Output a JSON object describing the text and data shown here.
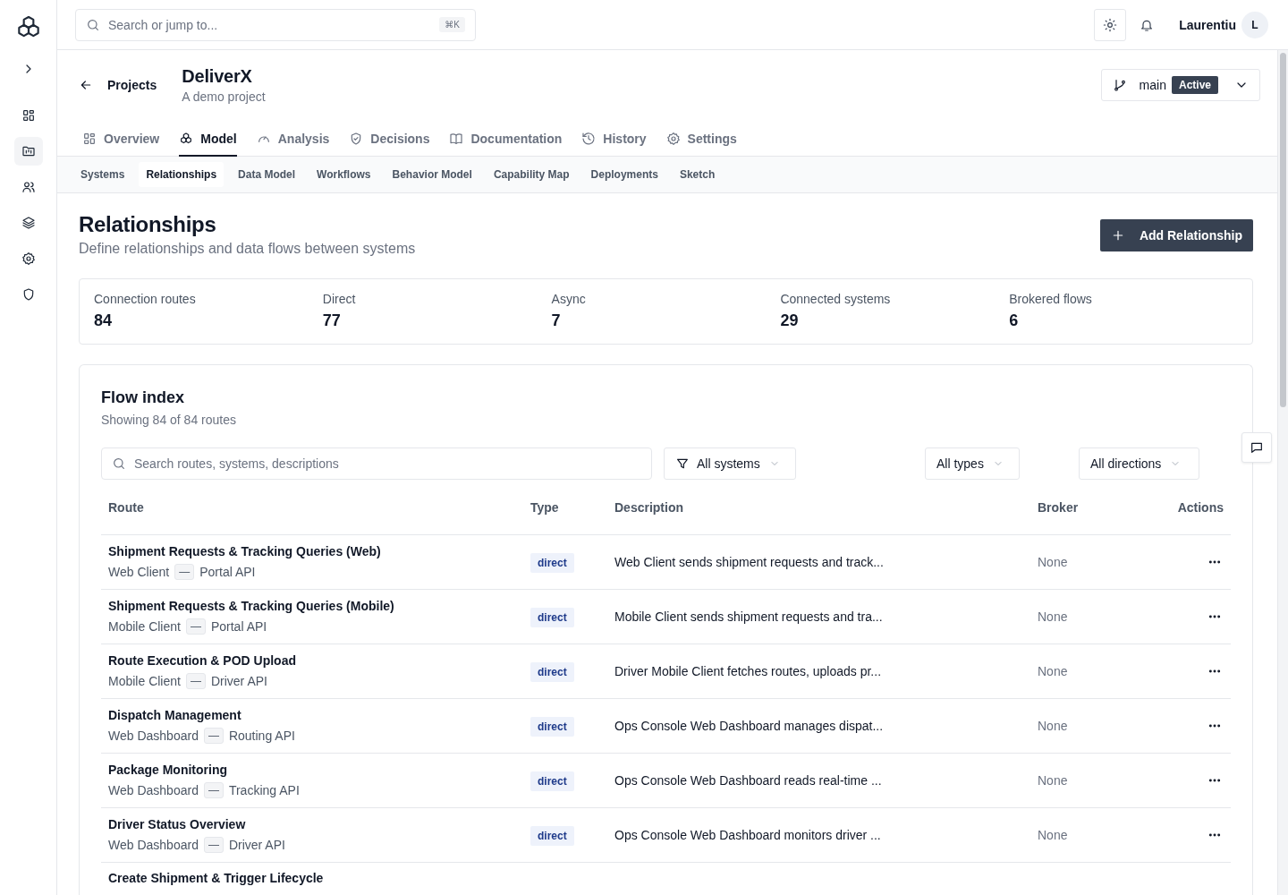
{
  "sidebar": {
    "items": [
      {
        "selected": false
      },
      {
        "selected": true
      },
      {
        "selected": false
      },
      {
        "selected": false
      },
      {
        "selected": false
      },
      {
        "selected": false
      }
    ]
  },
  "topbar": {
    "search": {
      "placeholder": "Search or jump to..."
    },
    "shortcut": "⌘K",
    "user": "Laurentiu",
    "avatar": "L"
  },
  "header": {
    "back": "Projects",
    "title": "DeliverX",
    "subtitle": "A demo project",
    "branch": "main",
    "branch_status": "Active"
  },
  "tabs": [
    {
      "label": "Overview",
      "selected": false
    },
    {
      "label": "Model",
      "selected": true
    },
    {
      "label": "Analysis",
      "selected": false
    },
    {
      "label": "Decisions",
      "selected": false
    },
    {
      "label": "Documentation",
      "selected": false
    },
    {
      "label": "History",
      "selected": false
    },
    {
      "label": "Settings",
      "selected": false
    }
  ],
  "subtabs": [
    {
      "label": "Systems",
      "selected": false
    },
    {
      "label": "Relationships",
      "selected": true
    },
    {
      "label": "Data Model",
      "selected": false
    },
    {
      "label": "Workflows",
      "selected": false
    },
    {
      "label": "Behavior Model",
      "selected": false
    },
    {
      "label": "Capability Map",
      "selected": false
    },
    {
      "label": "Deployments",
      "selected": false
    },
    {
      "label": "Sketch",
      "selected": false
    }
  ],
  "page": {
    "title": "Relationships",
    "subtitle": "Define relationships and data flows between systems",
    "add_button": "Add Relationship"
  },
  "stats": [
    {
      "label": "Connection routes",
      "value": "84"
    },
    {
      "label": "Direct",
      "value": "77"
    },
    {
      "label": "Async",
      "value": "7"
    },
    {
      "label": "Connected systems",
      "value": "29"
    },
    {
      "label": "Brokered flows",
      "value": "6"
    }
  ],
  "flow_index": {
    "title": "Flow index",
    "subtitle": "Showing 84 of 84 routes",
    "search": {
      "placeholder": "Search routes, systems, descriptions"
    },
    "filters": [
      "All systems",
      "All types",
      "All directions"
    ],
    "table": {
      "columns": [
        "Route",
        "Type",
        "Description",
        "Broker",
        "Actions"
      ],
      "rows": [
        {
          "route": "Shipment Requests & Tracking Queries (Web)",
          "path": [
            {
              "kind": "system",
              "text": "Web Client"
            },
            {
              "kind": "link",
              "text": "—"
            },
            {
              "kind": "system",
              "text": "Portal API"
            }
          ],
          "type": "direct",
          "description": "Web Client sends shipment requests and track...",
          "broker": "None"
        },
        {
          "route": "Shipment Requests & Tracking Queries (Mobile)",
          "path": [
            {
              "kind": "system",
              "text": "Mobile Client"
            },
            {
              "kind": "link",
              "text": "—"
            },
            {
              "kind": "system",
              "text": "Portal API"
            }
          ],
          "type": "direct",
          "description": "Mobile Client sends shipment requests and tra...",
          "broker": "None"
        },
        {
          "route": "Route Execution & POD Upload",
          "path": [
            {
              "kind": "system",
              "text": "Mobile Client"
            },
            {
              "kind": "link",
              "text": "—"
            },
            {
              "kind": "system",
              "text": "Driver API"
            }
          ],
          "type": "direct",
          "description": "Driver Mobile Client fetches routes, uploads pr...",
          "broker": "None"
        },
        {
          "route": "Dispatch Management",
          "path": [
            {
              "kind": "system",
              "text": "Web Dashboard"
            },
            {
              "kind": "link",
              "text": "—"
            },
            {
              "kind": "system",
              "text": "Routing API"
            }
          ],
          "type": "direct",
          "description": "Ops Console Web Dashboard manages dispat...",
          "broker": "None"
        },
        {
          "route": "Package Monitoring",
          "path": [
            {
              "kind": "system",
              "text": "Web Dashboard"
            },
            {
              "kind": "link",
              "text": "—"
            },
            {
              "kind": "system",
              "text": "Tracking API"
            }
          ],
          "type": "direct",
          "description": "Ops Console Web Dashboard reads real-time ...",
          "broker": "None"
        },
        {
          "route": "Driver Status Overview",
          "path": [
            {
              "kind": "system",
              "text": "Web Dashboard"
            },
            {
              "kind": "link",
              "text": "—"
            },
            {
              "kind": "system",
              "text": "Driver API"
            }
          ],
          "type": "direct",
          "description": "Ops Console Web Dashboard monitors driver ...",
          "broker": "None"
        },
        {
          "route": "Create Shipment & Trigger Lifecycle"
        }
      ]
    }
  }
}
